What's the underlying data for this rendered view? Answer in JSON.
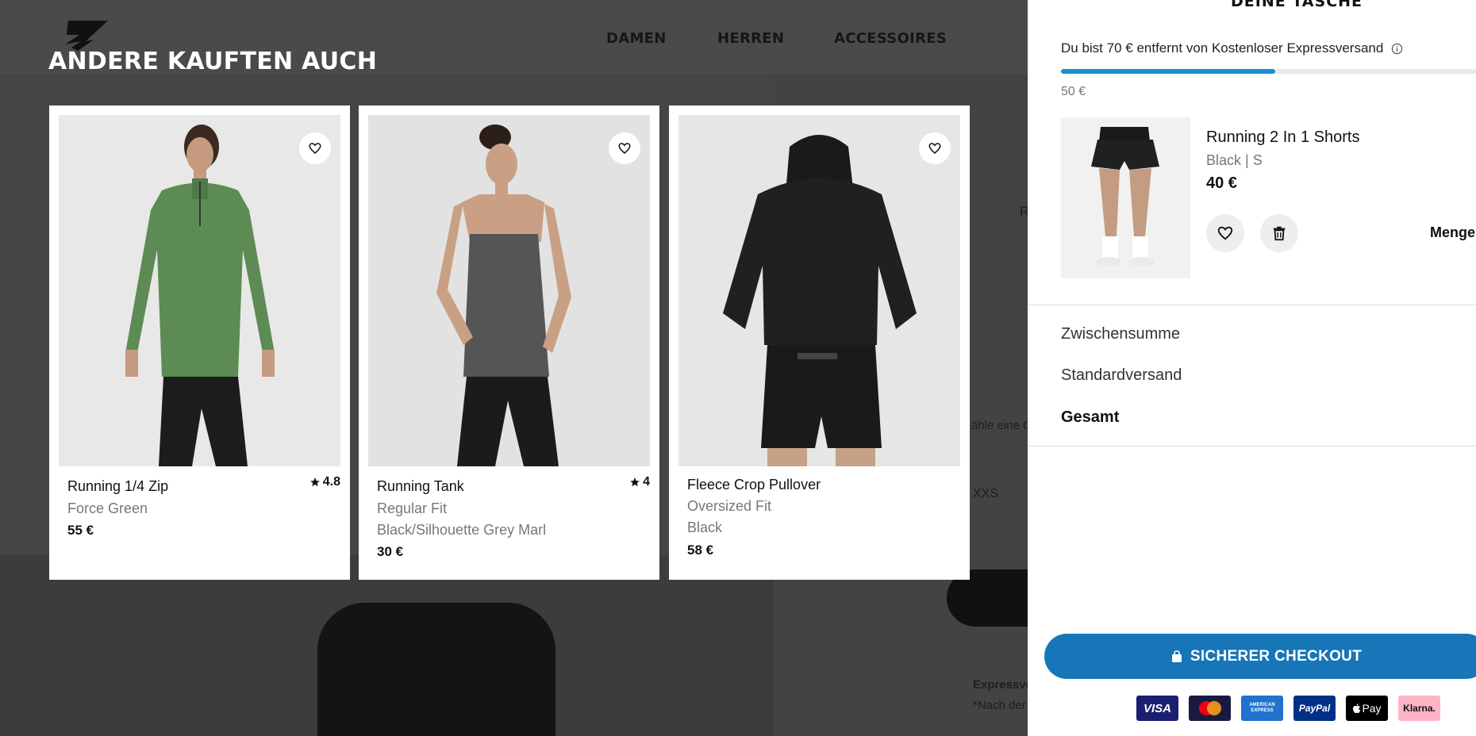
{
  "background": {
    "nav": [
      "DAMEN",
      "HERREN",
      "ACCESSOIRES"
    ],
    "fragments": [
      "R",
      "ähle eine G",
      "XXS",
      "Expressve",
      "*Nach der"
    ]
  },
  "recommendations": {
    "title": "ANDERE KAUFTEN AUCH",
    "products": [
      {
        "name": "Running 1/4 Zip",
        "rating": "4.8",
        "line2": "Force Green",
        "line3": "",
        "price": "55 €"
      },
      {
        "name": "Running Tank",
        "rating": "4",
        "line2": "Regular Fit",
        "line3": "Black/Silhouette Grey Marl",
        "price": "30 €"
      },
      {
        "name": "Fleece Crop Pullover",
        "rating": "",
        "line2": "Oversized Fit",
        "line3": "Black",
        "price": "58 €"
      }
    ]
  },
  "cart": {
    "title": "DEINE TASCHE",
    "shipping_message": "Du bist 70 € entfernt von Kostenloser Expressversand",
    "progress_fraction": 0.5,
    "progress_label": "50 €",
    "item": {
      "name": "Running 2 In 1 Shorts",
      "variant": "Black | S",
      "price": "40 €",
      "quantity_label": "Menge"
    },
    "summary": {
      "subtotal": "Zwischensumme",
      "shipping": "Standardversand",
      "total": "Gesamt"
    },
    "checkout_label": "SICHERER CHECKOUT",
    "payment_methods": [
      "VISA",
      "Mastercard",
      "AMERICAN EXPRESS",
      "PayPal",
      "Pay",
      "Klarna."
    ]
  },
  "colors": {
    "accent": "#1676b8",
    "progress": "#1a8fd0",
    "klarna": "#ffb3c7",
    "visa": "#1a1f71"
  }
}
